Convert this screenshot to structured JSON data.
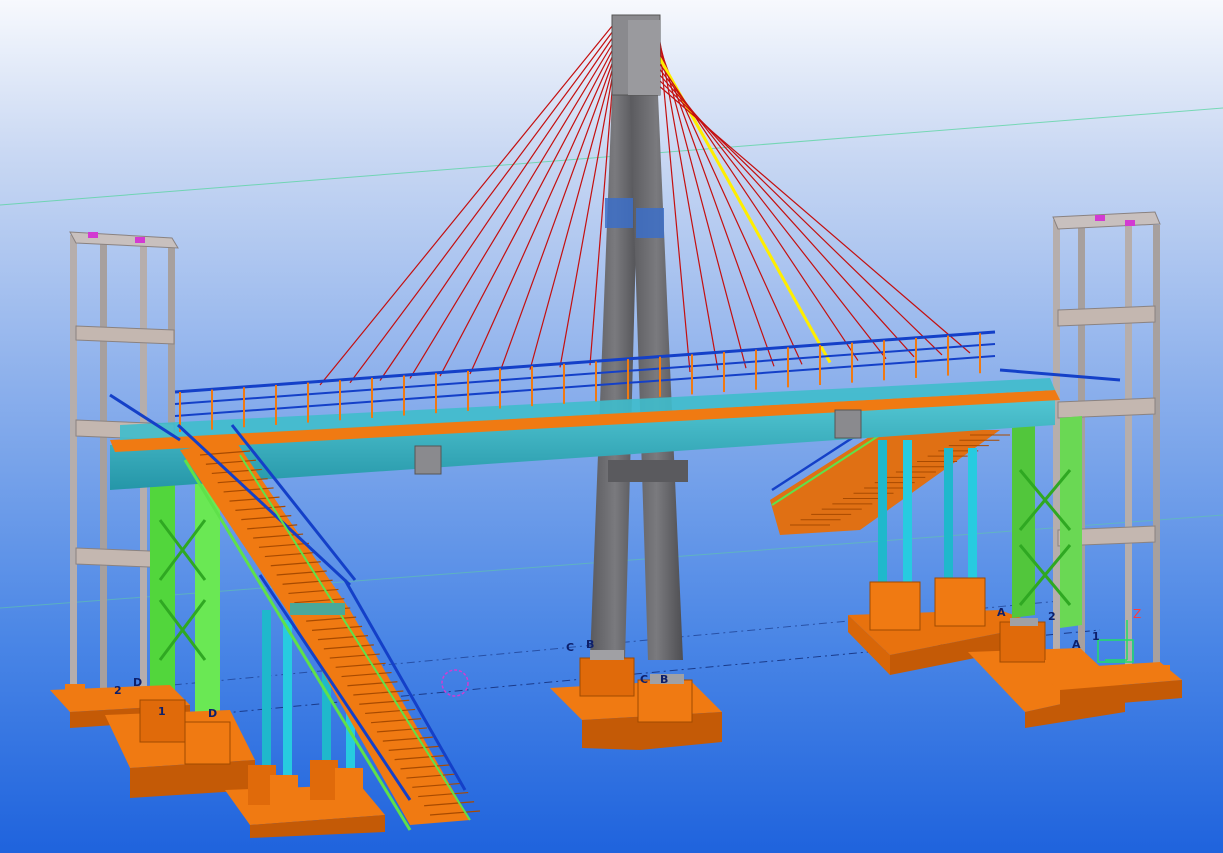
{
  "viewport": {
    "background_top": "#f7f9fd",
    "background_bottom": "#1f63dd"
  },
  "gridlines": {
    "A": "A",
    "B": "B",
    "C": "C",
    "D": "D",
    "one": "1",
    "two": "2"
  },
  "axis_indicator": {
    "z_label": "Z"
  },
  "colors": {
    "pylon": "#6c6c6f",
    "pylon_dark": "#4e4e52",
    "cable": "#c40f0f",
    "cable_selected": "#ffee00",
    "deck": "#39b6c4",
    "deck_dark": "#1f8aa0",
    "foundation": "#f07a12",
    "foundation_dark": "#c45a06",
    "tower": "#b8b0ae",
    "bracing": "#5fe14a",
    "railing": "#1440c8",
    "stair": "#f07a12",
    "column": "#21c3d6",
    "gridline": "#1a3a8a"
  }
}
